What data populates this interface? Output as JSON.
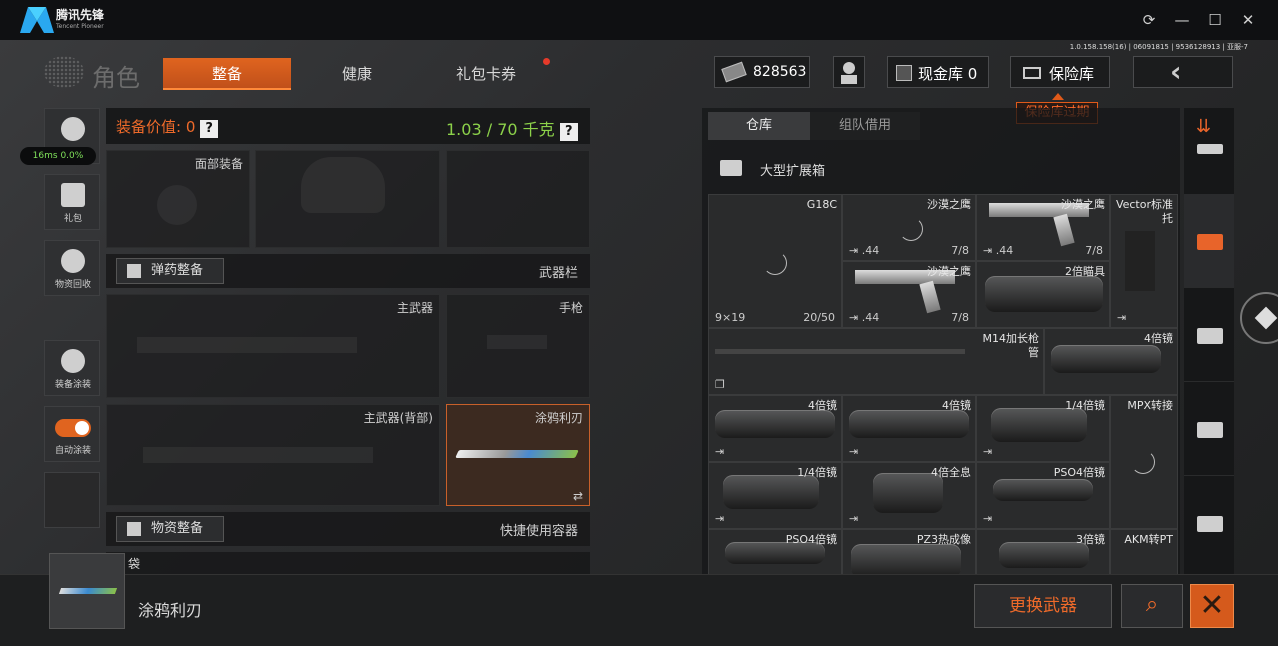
{
  "titlebar": {
    "app_name": "腾讯先锋",
    "app_sub": "Tencent Pioneer",
    "icons": [
      "refresh-icon",
      "minimize-icon",
      "maximize-icon",
      "close-icon"
    ]
  },
  "version": "1.0.158.158(16) | 06091815 | 9536128913 | 亚服-7",
  "header": {
    "role": "角色",
    "tabs": [
      "整备",
      "健康",
      "礼包卡券"
    ],
    "active_tab": "整备",
    "money": "828563",
    "cash_label": "现金库 0",
    "vault_label": "保险库",
    "vault_tooltip": "保险库过期"
  },
  "ping": "16ms 0.0%",
  "side": {
    "items": [
      {
        "label": "",
        "icon": "helmet-icon"
      },
      {
        "label": "礼包",
        "icon": "gift-icon"
      },
      {
        "label": "物资回收",
        "icon": "recycle-icon"
      },
      {
        "label": "装备涂装",
        "icon": "paint-icon"
      },
      {
        "label": "自动涂装",
        "icon": "toggle-icon"
      }
    ]
  },
  "equipment": {
    "value_label": "装备价值: 0",
    "weight_label": "1.03 / 70 千克",
    "face_slot": "面部装备",
    "ammo_button": "弹药整备",
    "weapon_bar": "武器栏",
    "primary": "主武器",
    "pistol": "手枪",
    "primary_back": "主武器(背部)",
    "melee": "涂鸦利刃",
    "supply_button": "物资整备",
    "quick_container": "快捷使用容器",
    "bag": "袋"
  },
  "storage": {
    "tabs": [
      "仓库",
      "组队借用"
    ],
    "container": "大型扩展箱",
    "items": [
      {
        "name": "G18C",
        "bl": "9×19",
        "br": "20/50"
      },
      {
        "name": "沙漠之鹰",
        "bl": ".44",
        "br": "7/8"
      },
      {
        "name": "沙漠之鹰",
        "bl": ".44",
        "br": "7/8"
      },
      {
        "name": "Vector标准托",
        "bl": "",
        "br": ""
      },
      {
        "name": "沙漠之鹰",
        "bl": ".44",
        "br": "7/8"
      },
      {
        "name": "2倍瞄具",
        "bl": "",
        "br": ""
      },
      {
        "name": "M14加长枪管",
        "bl": "",
        "br": ""
      },
      {
        "name": "4倍镜",
        "bl": "",
        "br": ""
      },
      {
        "name": "4倍镜",
        "bl": "",
        "br": ""
      },
      {
        "name": "4倍镜",
        "bl": "",
        "br": ""
      },
      {
        "name": "1/4倍镜",
        "bl": "",
        "br": ""
      },
      {
        "name": "MPX转接",
        "bl": "",
        "br": ""
      },
      {
        "name": "1/4倍镜",
        "bl": "",
        "br": ""
      },
      {
        "name": "4倍全息",
        "bl": "",
        "br": ""
      },
      {
        "name": "PSO4倍镜",
        "bl": "",
        "br": ""
      },
      {
        "name": "PSO4倍镜",
        "bl": "",
        "br": ""
      },
      {
        "name": "PZ3热成像",
        "bl": "",
        "br": ""
      },
      {
        "name": "3倍镜",
        "bl": "",
        "br": ""
      },
      {
        "name": "AKM转PT",
        "bl": "",
        "br": ""
      }
    ]
  },
  "bottom": {
    "item_name": "涂鸦利刃",
    "swap_button": "更换武器"
  },
  "colors": {
    "accent": "#e0641f",
    "weight": "#8cd14a",
    "ping": "#7fe05a"
  }
}
